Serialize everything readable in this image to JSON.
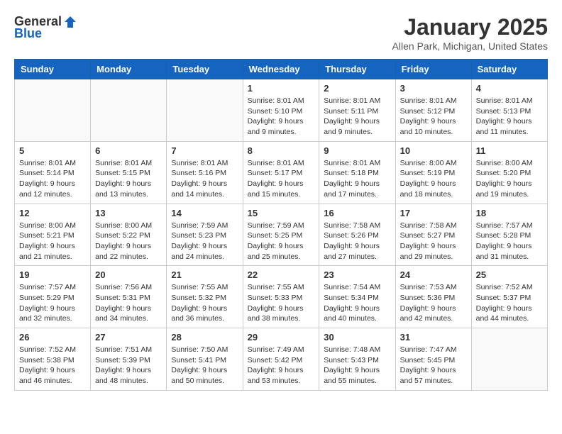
{
  "header": {
    "logo_general": "General",
    "logo_blue": "Blue",
    "title": "January 2025",
    "location": "Allen Park, Michigan, United States"
  },
  "weekdays": [
    "Sunday",
    "Monday",
    "Tuesday",
    "Wednesday",
    "Thursday",
    "Friday",
    "Saturday"
  ],
  "weeks": [
    [
      {
        "day": "",
        "info": ""
      },
      {
        "day": "",
        "info": ""
      },
      {
        "day": "",
        "info": ""
      },
      {
        "day": "1",
        "info": "Sunrise: 8:01 AM\nSunset: 5:10 PM\nDaylight: 9 hours and 9 minutes."
      },
      {
        "day": "2",
        "info": "Sunrise: 8:01 AM\nSunset: 5:11 PM\nDaylight: 9 hours and 9 minutes."
      },
      {
        "day": "3",
        "info": "Sunrise: 8:01 AM\nSunset: 5:12 PM\nDaylight: 9 hours and 10 minutes."
      },
      {
        "day": "4",
        "info": "Sunrise: 8:01 AM\nSunset: 5:13 PM\nDaylight: 9 hours and 11 minutes."
      }
    ],
    [
      {
        "day": "5",
        "info": "Sunrise: 8:01 AM\nSunset: 5:14 PM\nDaylight: 9 hours and 12 minutes."
      },
      {
        "day": "6",
        "info": "Sunrise: 8:01 AM\nSunset: 5:15 PM\nDaylight: 9 hours and 13 minutes."
      },
      {
        "day": "7",
        "info": "Sunrise: 8:01 AM\nSunset: 5:16 PM\nDaylight: 9 hours and 14 minutes."
      },
      {
        "day": "8",
        "info": "Sunrise: 8:01 AM\nSunset: 5:17 PM\nDaylight: 9 hours and 15 minutes."
      },
      {
        "day": "9",
        "info": "Sunrise: 8:01 AM\nSunset: 5:18 PM\nDaylight: 9 hours and 17 minutes."
      },
      {
        "day": "10",
        "info": "Sunrise: 8:00 AM\nSunset: 5:19 PM\nDaylight: 9 hours and 18 minutes."
      },
      {
        "day": "11",
        "info": "Sunrise: 8:00 AM\nSunset: 5:20 PM\nDaylight: 9 hours and 19 minutes."
      }
    ],
    [
      {
        "day": "12",
        "info": "Sunrise: 8:00 AM\nSunset: 5:21 PM\nDaylight: 9 hours and 21 minutes."
      },
      {
        "day": "13",
        "info": "Sunrise: 8:00 AM\nSunset: 5:22 PM\nDaylight: 9 hours and 22 minutes."
      },
      {
        "day": "14",
        "info": "Sunrise: 7:59 AM\nSunset: 5:23 PM\nDaylight: 9 hours and 24 minutes."
      },
      {
        "day": "15",
        "info": "Sunrise: 7:59 AM\nSunset: 5:25 PM\nDaylight: 9 hours and 25 minutes."
      },
      {
        "day": "16",
        "info": "Sunrise: 7:58 AM\nSunset: 5:26 PM\nDaylight: 9 hours and 27 minutes."
      },
      {
        "day": "17",
        "info": "Sunrise: 7:58 AM\nSunset: 5:27 PM\nDaylight: 9 hours and 29 minutes."
      },
      {
        "day": "18",
        "info": "Sunrise: 7:57 AM\nSunset: 5:28 PM\nDaylight: 9 hours and 31 minutes."
      }
    ],
    [
      {
        "day": "19",
        "info": "Sunrise: 7:57 AM\nSunset: 5:29 PM\nDaylight: 9 hours and 32 minutes."
      },
      {
        "day": "20",
        "info": "Sunrise: 7:56 AM\nSunset: 5:31 PM\nDaylight: 9 hours and 34 minutes."
      },
      {
        "day": "21",
        "info": "Sunrise: 7:55 AM\nSunset: 5:32 PM\nDaylight: 9 hours and 36 minutes."
      },
      {
        "day": "22",
        "info": "Sunrise: 7:55 AM\nSunset: 5:33 PM\nDaylight: 9 hours and 38 minutes."
      },
      {
        "day": "23",
        "info": "Sunrise: 7:54 AM\nSunset: 5:34 PM\nDaylight: 9 hours and 40 minutes."
      },
      {
        "day": "24",
        "info": "Sunrise: 7:53 AM\nSunset: 5:36 PM\nDaylight: 9 hours and 42 minutes."
      },
      {
        "day": "25",
        "info": "Sunrise: 7:52 AM\nSunset: 5:37 PM\nDaylight: 9 hours and 44 minutes."
      }
    ],
    [
      {
        "day": "26",
        "info": "Sunrise: 7:52 AM\nSunset: 5:38 PM\nDaylight: 9 hours and 46 minutes."
      },
      {
        "day": "27",
        "info": "Sunrise: 7:51 AM\nSunset: 5:39 PM\nDaylight: 9 hours and 48 minutes."
      },
      {
        "day": "28",
        "info": "Sunrise: 7:50 AM\nSunset: 5:41 PM\nDaylight: 9 hours and 50 minutes."
      },
      {
        "day": "29",
        "info": "Sunrise: 7:49 AM\nSunset: 5:42 PM\nDaylight: 9 hours and 53 minutes."
      },
      {
        "day": "30",
        "info": "Sunrise: 7:48 AM\nSunset: 5:43 PM\nDaylight: 9 hours and 55 minutes."
      },
      {
        "day": "31",
        "info": "Sunrise: 7:47 AM\nSunset: 5:45 PM\nDaylight: 9 hours and 57 minutes."
      },
      {
        "day": "",
        "info": ""
      }
    ]
  ]
}
